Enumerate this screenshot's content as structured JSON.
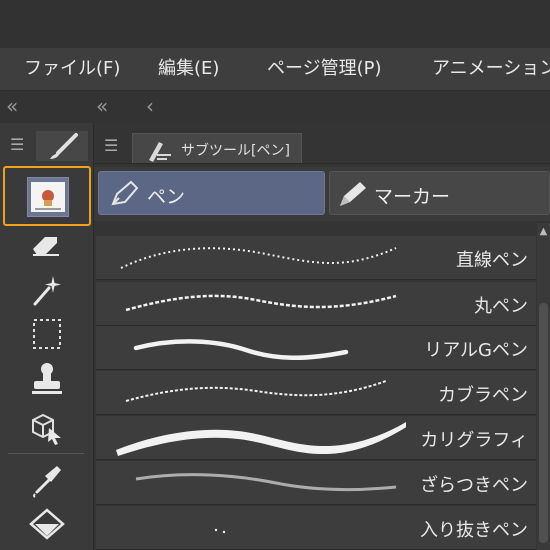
{
  "menu": [
    {
      "label": "ファイル(F)"
    },
    {
      "label": "編集(E)"
    },
    {
      "label": "ページ管理(P)"
    },
    {
      "label": "アニメーション("
    }
  ],
  "collapse": {
    "left": "«",
    "mid": "«",
    "back": "‹"
  },
  "tools": [
    {
      "icon": "brush-icon"
    },
    {
      "icon": "selected-tool-thumbnail"
    },
    {
      "icon": "eraser-icon"
    },
    {
      "icon": "auto-select-wand-icon"
    },
    {
      "icon": "selection-rect-icon"
    },
    {
      "icon": "stamp-icon"
    },
    {
      "icon": "3d-object-operation-icon"
    },
    {
      "icon": "eyedropper-icon"
    },
    {
      "icon": "fill-bucket-icon"
    }
  ],
  "subtool": {
    "tab_label": "サブツール[ペン]",
    "groups": [
      {
        "label": "ペン",
        "selected": true
      },
      {
        "label": "マーカー",
        "selected": false
      }
    ],
    "items": [
      {
        "label": "直線ペン"
      },
      {
        "label": "丸ペン"
      },
      {
        "label": "リアルGペン"
      },
      {
        "label": "カブラペン"
      },
      {
        "label": "カリグラフィ"
      },
      {
        "label": "ざらつきペン"
      },
      {
        "label": "入り抜きペン"
      }
    ]
  },
  "colors": {
    "accent": "#f0a21e",
    "selected_group": "#5b6784"
  }
}
